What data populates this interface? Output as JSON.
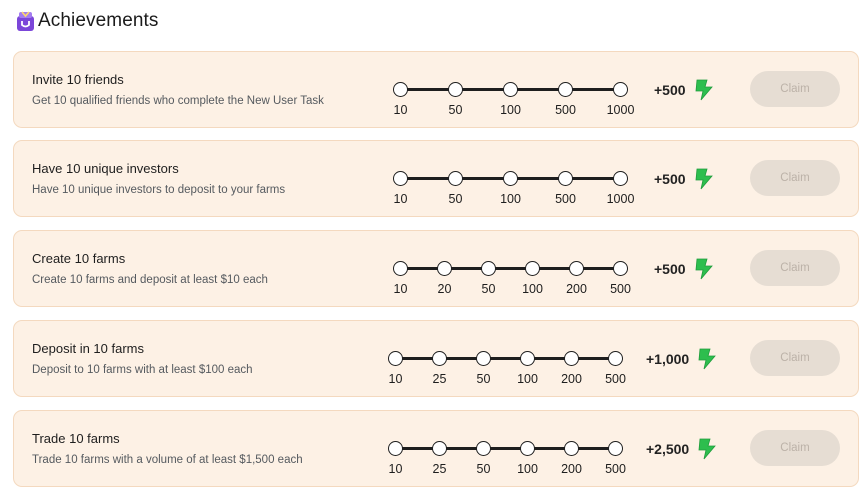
{
  "header": {
    "title": "Achievements",
    "icon": "trophy-icon"
  },
  "colors": {
    "card_bg": "#fdf1e5",
    "card_border": "#f4d9bf",
    "bolt": "#2dbe4e",
    "claim_bg": "#e6ddd3",
    "claim_text": "#bcb2a8",
    "trophy": "#7b46d9"
  },
  "achievements": [
    {
      "title": "Invite 10 friends",
      "desc": "Get 10 qualified friends who complete the New User Task",
      "milestones": [
        "10",
        "50",
        "100",
        "500",
        "1000"
      ],
      "reward": "+500",
      "claim": "Claim"
    },
    {
      "title": "Have 10 unique investors",
      "desc": "Have 10 unique investors to deposit to your farms",
      "milestones": [
        "10",
        "50",
        "100",
        "500",
        "1000"
      ],
      "reward": "+500",
      "claim": "Claim"
    },
    {
      "title": "Create 10 farms",
      "desc": "Create 10 farms and deposit at least $10 each",
      "milestones": [
        "10",
        "20",
        "50",
        "100",
        "200",
        "500"
      ],
      "reward": "+500",
      "claim": "Claim"
    },
    {
      "title": "Deposit in 10 farms",
      "desc": "Deposit to 10 farms with at least $100 each",
      "milestones": [
        "10",
        "25",
        "50",
        "100",
        "200",
        "500"
      ],
      "reward": "+1,000",
      "claim": "Claim"
    },
    {
      "title": "Trade 10 farms",
      "desc": "Trade 10 farms with a volume of at least $1,500 each",
      "milestones": [
        "10",
        "25",
        "50",
        "100",
        "200",
        "500"
      ],
      "reward": "+2,500",
      "claim": "Claim"
    }
  ]
}
